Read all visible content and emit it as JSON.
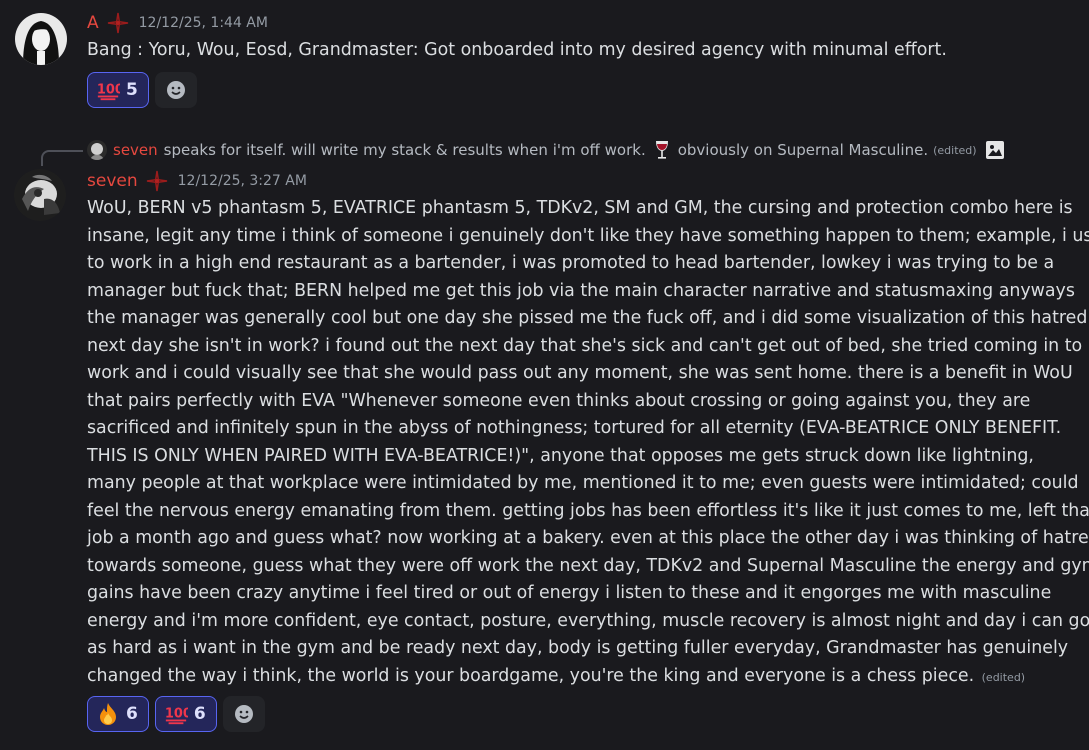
{
  "messages": [
    {
      "author": "A",
      "author_color": "#e5483f",
      "timestamp": "12/12/25, 1:44 AM",
      "role_icon": "red-star-cross-icon",
      "content": "Bang : Yoru, Wou, Eosd, Grandmaster: Got onboarded into my desired agency with minumal effort.",
      "reactions": [
        {
          "emoji": "hundred-points-icon",
          "count": "5"
        }
      ]
    },
    {
      "author": "seven",
      "author_color": "#e5483f",
      "timestamp": "12/12/25, 3:27 AM",
      "role_icon": "red-star-cross-icon",
      "reply": {
        "author": "seven",
        "text_before": "speaks for itself. will write my stack & results when i'm off work.",
        "emoji": "wine-glass-icon",
        "text_after": "obviously on Supernal Masculine.",
        "edited_label": "(edited)",
        "attachment_icon": "image-icon"
      },
      "lines": [
        "WoU, BERN v5 phantasm 5, EVATRICE phantasm 5, TDKv2, SM and GM, the cursing and protection combo here is",
        "insane, legit any time i think of someone i genuinely don't like they have something happen to them; example, i used",
        "to work in a high end restaurant as a bartender, i was promoted to head bartender, lowkey i was trying to be a",
        "manager but fuck that; BERN helped me get this job via the main character narrative and statusmaxing anyways",
        "the manager was generally cool but one day she pissed me the fuck off, and i did some visualization of this hatred.",
        "next day she isn't in work? i found out the next day that she's sick and can't get out of bed, she tried coming in to",
        "work and i could visually see that she would pass out any moment, she was sent home. there is a benefit in WoU",
        "that pairs perfectly with EVA \"Whenever someone even thinks about crossing or going against you, they are",
        "sacrificed and infinitely spun in the abyss of nothingness; tortured for all eternity (EVA-BEATRICE ONLY BENEFIT.",
        "THIS IS ONLY WHEN PAIRED WITH EVA-BEATRICE!)\", anyone that opposes me gets struck down like lightning,",
        "many people at that workplace were intimidated by me, mentioned it to me; even guests were intimidated; could",
        "feel the nervous energy emanating from them. getting jobs has been effortless it's like it just comes to me, left that",
        "job a month ago and guess what? now working at a bakery. even at this place the other day i was thinking of hatred",
        "towards someone, guess what they were off work the next day, TDKv2 and Supernal Masculine the energy and gym",
        "gains have been crazy anytime i feel tired or out of energy i listen to these and it engorges me with masculine",
        "energy and i'm more confident, eye contact, posture, everything, muscle recovery is almost night and day i can go",
        "as hard as i want in the gym and be ready next day, body is getting fuller everyday, Grandmaster has genuinely",
        "changed the way i think, the world is your boardgame, you're the king and everyone is a chess piece."
      ],
      "edited_label": "(edited)",
      "reactions": [
        {
          "emoji": "fire-icon",
          "count": "6"
        },
        {
          "emoji": "hundred-points-icon",
          "count": "6"
        }
      ]
    }
  ],
  "colors": {
    "background": "#1a1a1e",
    "text": "#dbdee1",
    "muted": "#949ba4",
    "username": "#e5483f",
    "reaction_bg": "#24265a",
    "reaction_border": "#5865f2",
    "add_reaction_bg": "#232428"
  },
  "icons": {
    "add_reaction": "add-reaction-smiley-icon"
  }
}
